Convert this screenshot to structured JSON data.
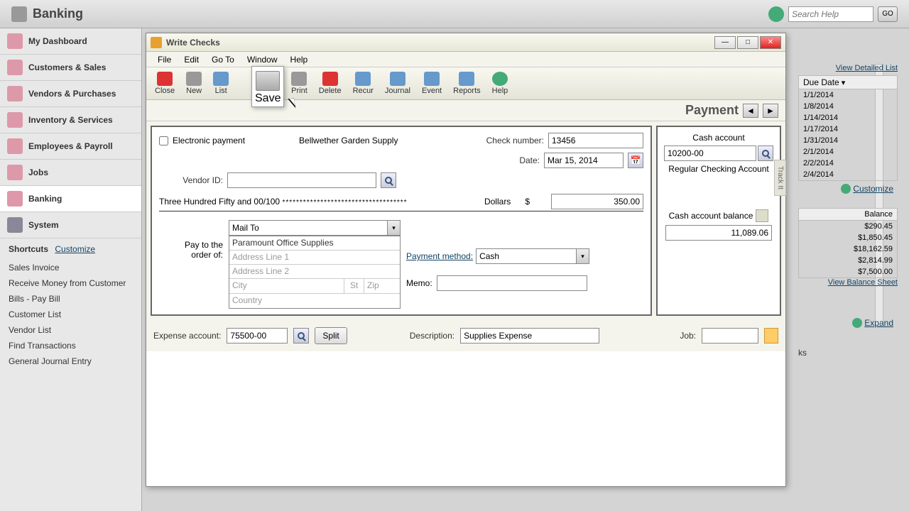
{
  "topbar": {
    "title": "Banking",
    "search_ph": "Search Help",
    "go": "GO"
  },
  "nav": {
    "items": [
      "My Dashboard",
      "Customers & Sales",
      "Vendors & Purchases",
      "Inventory & Services",
      "Employees & Payroll",
      "Jobs",
      "Banking",
      "System"
    ],
    "shortcuts_label": "Shortcuts",
    "customize": "Customize",
    "shortcuts": [
      "Sales Invoice",
      "Receive Money from Customer",
      "Bills - Pay Bill",
      "Customer List",
      "Vendor List",
      "Find Transactions",
      "General Journal Entry"
    ]
  },
  "right": {
    "view_detailed": "View Detailed List",
    "due_date_header": "Due Date",
    "dates": [
      "1/1/2014",
      "1/8/2014",
      "1/14/2014",
      "1/17/2014",
      "1/31/2014",
      "2/1/2014",
      "2/2/2014",
      "2/4/2014"
    ],
    "customize": "Customize",
    "balance_header": "Balance",
    "balances": [
      "$290.45",
      "$1,850.45",
      "$18,162.59",
      "$2,814.99",
      "$7,500.00"
    ],
    "view_balance_sheet": "View Balance Sheet",
    "expand": "Expand",
    "ks": "ks"
  },
  "dialog": {
    "title": "Write Checks",
    "menus": [
      "File",
      "Edit",
      "Go To",
      "Window",
      "Help"
    ],
    "tools": {
      "close": "Close",
      "new": "New",
      "list": "List",
      "save": "Save",
      "print": "Print",
      "delete": "Delete",
      "recur": "Recur",
      "journal": "Journal",
      "event": "Event",
      "reports": "Reports",
      "help": "Help"
    },
    "payment_title": "Payment",
    "electronic_payment": "Electronic payment",
    "company": "Bellwether Garden Supply",
    "check_number_lbl": "Check number:",
    "check_number": "13456",
    "date_lbl": "Date:",
    "date": "Mar 15, 2014",
    "vendor_id_lbl": "Vendor ID:",
    "vendor_id": "",
    "amount_words": "Three Hundred Fifty and 00/100",
    "dollars": "Dollars",
    "dollar_sign": "$",
    "amount": "350.00",
    "mail_to": "Mail To",
    "pay_to_lbl1": "Pay to the",
    "pay_to_lbl2": "order of:",
    "payee": "Paramount Office Supplies",
    "addr1_ph": "Address Line 1",
    "addr2_ph": "Address Line 2",
    "city_ph": "City",
    "st_ph": "St",
    "zip_ph": "Zip",
    "country_ph": "Country",
    "payment_method_lbl": "Payment method:",
    "payment_method": "Cash",
    "memo_lbl": "Memo:",
    "memo": "",
    "cash_account_lbl": "Cash account",
    "cash_account": "10200-00",
    "cash_account_name": "Regular Checking Account",
    "cab_lbl": "Cash account balance",
    "cab": "11,089.06",
    "expense_lbl": "Expense account:",
    "expense": "75500-00",
    "split": "Split",
    "description_lbl": "Description:",
    "description": "Supplies Expense",
    "job_lbl": "Job:",
    "job": "",
    "track": "Track It"
  }
}
